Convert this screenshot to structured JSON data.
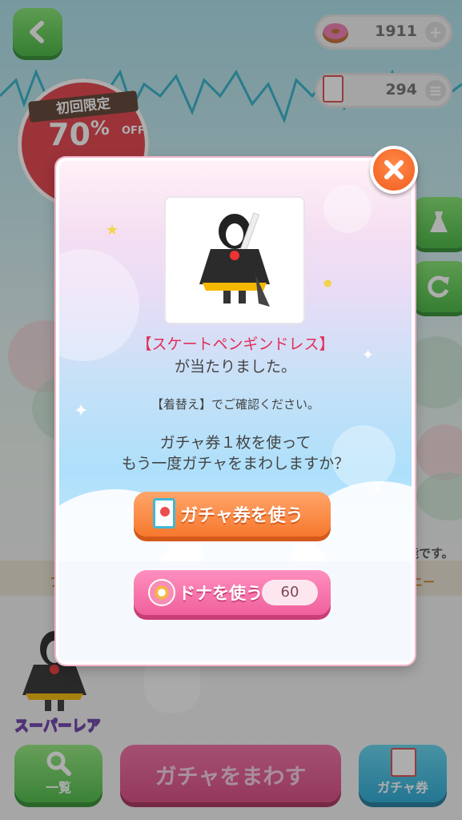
{
  "header": {
    "donut_count": "1911",
    "ticket_count": "294",
    "donut_add_icon": "plus-icon",
    "ticket_menu_icon": "list-icon"
  },
  "promo": {
    "label": "初回限定",
    "percent": "70",
    "percent_sign": "%",
    "off": "OFF"
  },
  "background": {
    "partial_right_text": "能です。",
    "partial_right_tag": "ニー",
    "partial_left_tag": "フ",
    "rarity": "スーパーレア"
  },
  "bottom": {
    "search_label": "一覧",
    "spin_label": "ガチャをまわす",
    "ticket_label": "ガチャ券"
  },
  "modal": {
    "item_name": "【スケートペンギンドレス】",
    "won_text": "が当たりました。",
    "confirm_text": "【着替え】でご確認ください。",
    "question_line1": "ガチャ券１枚を使って",
    "question_line2": "もう一度ガチャをまわしますか？",
    "use_ticket_label": "ガチャ券を使う",
    "use_donut_label": "ドナを使う",
    "donut_cost": "60"
  },
  "colors": {
    "accent_pink": "#f0609c",
    "accent_orange": "#f7782d",
    "green": "#46b940",
    "item_name_red": "#e0305a"
  }
}
